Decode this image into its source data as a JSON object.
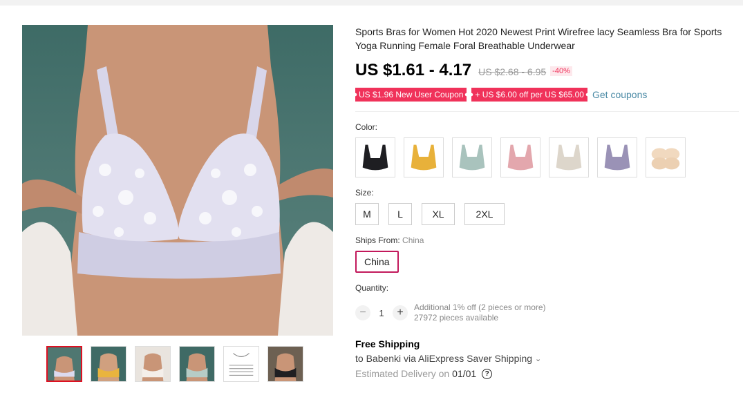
{
  "product": {
    "title": "Sports Bras for Women Hot 2020 Newest Print Wirefree lacy Seamless Bra for Sports Yoga Running Female Foral Breathable Underwear",
    "price": "US $1.61 - 4.17",
    "original_price": "US $2.68 - 6.95",
    "discount": "-40%"
  },
  "coupons": {
    "new_user": "US $1.96 New User Coupon",
    "store": "+ US $6.00 off per US $65.00",
    "get_link": "Get coupons"
  },
  "color": {
    "label": "Color:",
    "swatches": [
      {
        "name": "black",
        "color": "#1e1e22"
      },
      {
        "name": "yellow",
        "color": "#e8b13a"
      },
      {
        "name": "sage",
        "color": "#a9c3bd"
      },
      {
        "name": "pink",
        "color": "#e3a7ad"
      },
      {
        "name": "beige",
        "color": "#ddd6cb"
      },
      {
        "name": "purple",
        "color": "#9a92b6"
      },
      {
        "name": "nude-pads",
        "color": "#f1d9bf"
      }
    ]
  },
  "size": {
    "label": "Size:",
    "options": [
      "M",
      "L",
      "XL",
      "2XL"
    ]
  },
  "ships_from": {
    "label": "Ships From:",
    "value": "China",
    "option": "China"
  },
  "quantity": {
    "label": "Quantity:",
    "minus": "−",
    "plus": "+",
    "value": "1",
    "note_line1": "Additional 1% off (2 pieces or more)",
    "note_line2": "27972 pieces available"
  },
  "shipping": {
    "title": "Free Shipping",
    "detail": "to Babenki via AliExpress Saver Shipping",
    "delivery_label": "Estimated Delivery on",
    "delivery_date": "01/01"
  },
  "thumbnails": [
    {
      "name": "lavender-bra",
      "active": true
    },
    {
      "name": "yellow-bra",
      "active": false
    },
    {
      "name": "white-bra",
      "active": false
    },
    {
      "name": "sage-bra",
      "active": false
    },
    {
      "name": "size-chart",
      "active": false
    },
    {
      "name": "black-bra",
      "active": false
    }
  ],
  "colors": {
    "accent": "#f0325a",
    "link": "#4a8aa5",
    "selected_border": "#c2185b"
  }
}
